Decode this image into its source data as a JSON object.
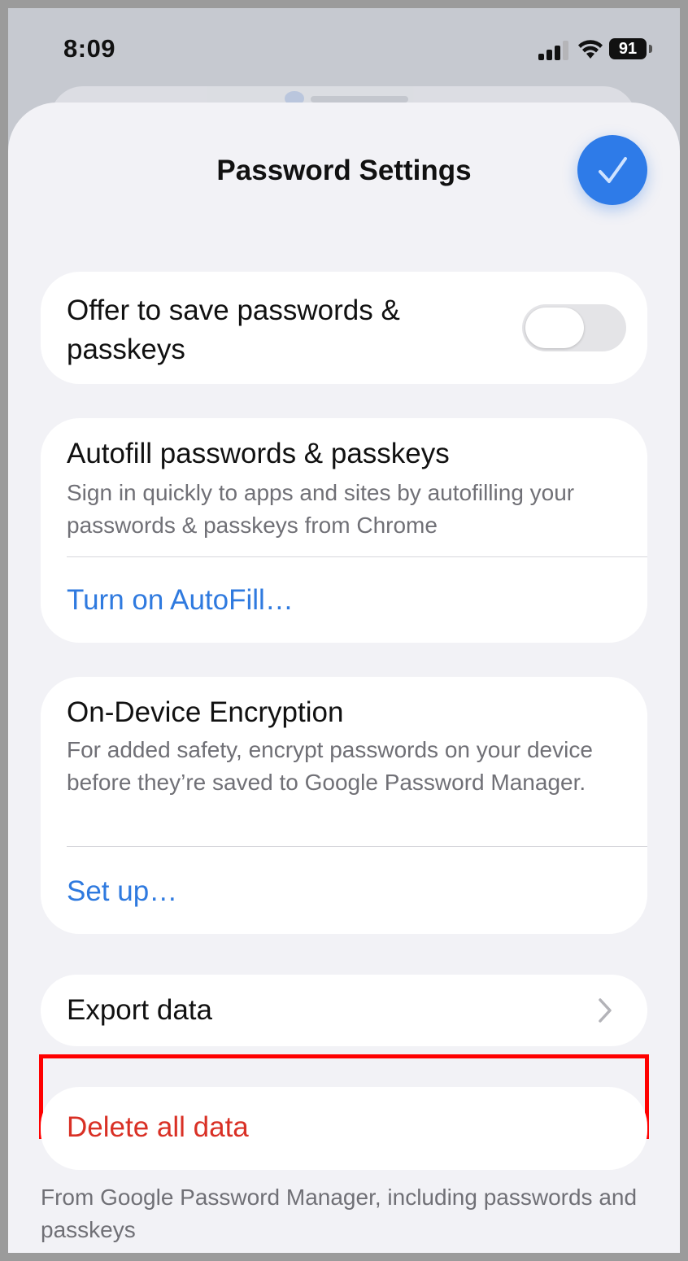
{
  "status_bar": {
    "time": "8:09",
    "battery": "91"
  },
  "header": {
    "title": "Password Settings"
  },
  "offer_save": {
    "label": "Offer to save passwords & passkeys",
    "toggle_on": false
  },
  "autofill": {
    "title": "Autofill passwords & passkeys",
    "description": "Sign in quickly to apps and sites by autofilling your passwords & passkeys from Chrome",
    "action": "Turn on AutoFill…"
  },
  "encryption": {
    "title": "On-Device Encryption",
    "description": "For added safety, encrypt passwords on your device before they’re saved to Google Password Manager.",
    "action": "Set up…"
  },
  "export": {
    "label": "Export data"
  },
  "delete": {
    "label": "Delete all data",
    "footnote": "From Google Password Manager, including passwords and passkeys"
  },
  "colors": {
    "accent": "#2f7adf",
    "destructive": "#d93025",
    "highlight": "#ff0000"
  }
}
